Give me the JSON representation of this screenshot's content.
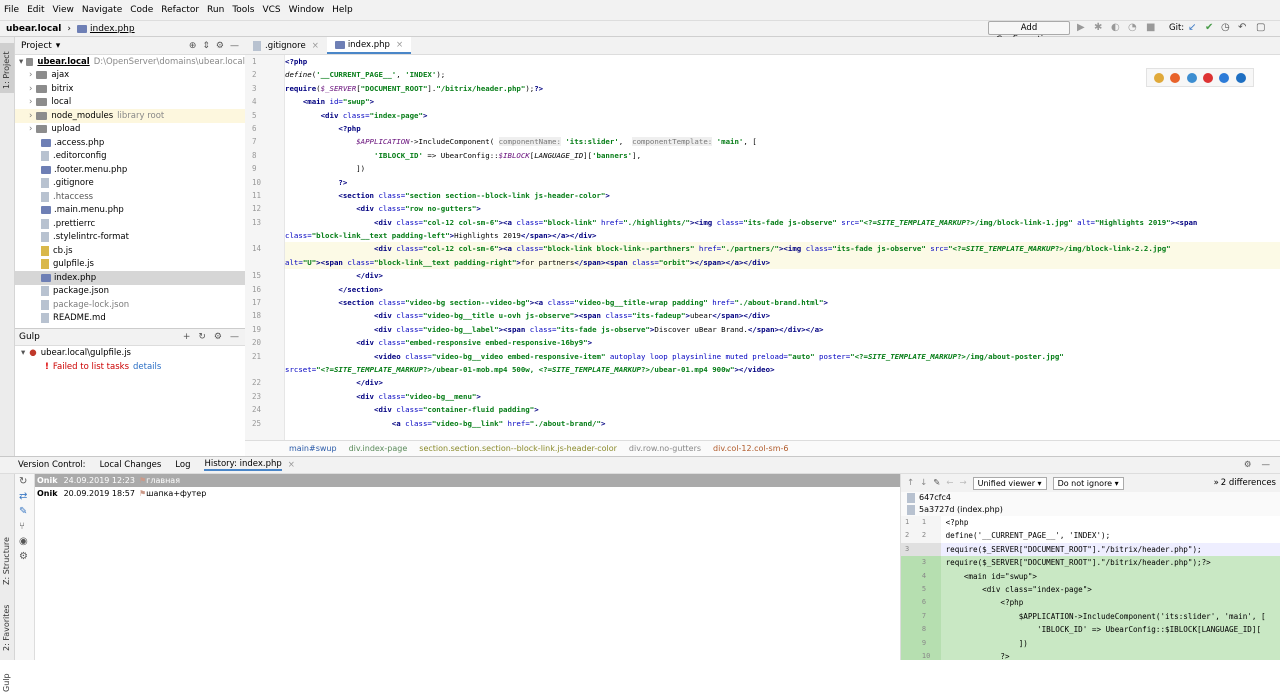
{
  "menu": [
    "File",
    "Edit",
    "View",
    "Navigate",
    "Code",
    "Refactor",
    "Run",
    "Tools",
    "VCS",
    "Window",
    "Help"
  ],
  "nav": {
    "project": "ubear.local",
    "file": "index.php"
  },
  "toolbar": {
    "add_config": "Add Configuration...",
    "git": "Git:"
  },
  "left_strip": {
    "project": "1: Project",
    "structure": "Z: Structure",
    "favorites": "2: Favorites",
    "gulp": "Gulp"
  },
  "project_panel": {
    "title": "Project",
    "root_name": "ubear.local",
    "root_path": "D:\\OpenServer\\domains\\ubear.local",
    "items": [
      {
        "name": "ajax",
        "type": "folder"
      },
      {
        "name": "bitrix",
        "type": "folder"
      },
      {
        "name": "local",
        "type": "folder"
      },
      {
        "name": "node_modules",
        "type": "folder",
        "note": "library root"
      },
      {
        "name": "upload",
        "type": "folder"
      },
      {
        "name": ".access.php",
        "type": "php"
      },
      {
        "name": ".editorconfig",
        "type": "file"
      },
      {
        "name": ".footer.menu.php",
        "type": "php"
      },
      {
        "name": ".gitignore",
        "type": "file"
      },
      {
        "name": ".htaccess",
        "type": "file"
      },
      {
        "name": ".main.menu.php",
        "type": "php"
      },
      {
        "name": ".prettierrc",
        "type": "file"
      },
      {
        "name": ".stylelintrc-format",
        "type": "file"
      },
      {
        "name": "cb.js",
        "type": "js"
      },
      {
        "name": "gulpfile.js",
        "type": "js"
      },
      {
        "name": "index.php",
        "type": "php"
      },
      {
        "name": "package.json",
        "type": "file"
      },
      {
        "name": "package-lock.json",
        "type": "file"
      },
      {
        "name": "README.md",
        "type": "file"
      }
    ]
  },
  "gulp": {
    "title": "Gulp",
    "file": "ubear.local\\gulpfile.js",
    "error": "Failed to list tasks",
    "details": "details"
  },
  "tabs": [
    ".gitignore",
    "index.php"
  ],
  "breadcrumb": [
    "main#swup",
    "div.index-page",
    "section.section.section--block-link.js-header-color",
    "div.row.no-gutters",
    "div.col-12.col-sm-6"
  ],
  "bottom": {
    "tabs": [
      "Version Control:",
      "Local Changes",
      "Log",
      "History: index.php"
    ],
    "log": [
      {
        "author": "Onik",
        "date": "24.09.2019 12:23",
        "msg": "главная"
      },
      {
        "author": "Onik",
        "date": "20.09.2019 18:57",
        "msg": "шапка+футер"
      }
    ],
    "viewer": "Unified viewer",
    "ignore": "Do not ignore",
    "diff_count": "2 differences",
    "rev1": "647cfc4",
    "rev2": "5a3727d (index.php)"
  },
  "diff": [
    {
      "a": "1",
      "b": "1",
      "t": "<?php",
      "k": ""
    },
    {
      "a": "2",
      "b": "2",
      "t": "define('__CURRENT_PAGE__', 'INDEX');",
      "k": ""
    },
    {
      "a": "3",
      "b": "",
      "t": "require($_SERVER[\"DOCUMENT_ROOT\"].\"/bitrix/header.php\");",
      "k": "gr"
    },
    {
      "a": "",
      "b": "3",
      "t": "require($_SERVER[\"DOCUMENT_ROOT\"].\"/bitrix/header.php\");?>",
      "k": "g"
    },
    {
      "a": "",
      "b": "4",
      "t": "    <main id=\"swup\">",
      "k": "g"
    },
    {
      "a": "",
      "b": "5",
      "t": "        <div class=\"index-page\">",
      "k": "g"
    },
    {
      "a": "",
      "b": "6",
      "t": "            <?php",
      "k": "g"
    },
    {
      "a": "",
      "b": "7",
      "t": "                $APPLICATION->IncludeComponent('its:slider', 'main', [",
      "k": "g"
    },
    {
      "a": "",
      "b": "8",
      "t": "                    'IBLOCK_ID' => UbearConfig::$IBLOCK[LANGUAGE_ID][",
      "k": "g"
    },
    {
      "a": "",
      "b": "9",
      "t": "                ])",
      "k": "g"
    },
    {
      "a": "",
      "b": "10",
      "t": "            ?>",
      "k": "g"
    }
  ]
}
